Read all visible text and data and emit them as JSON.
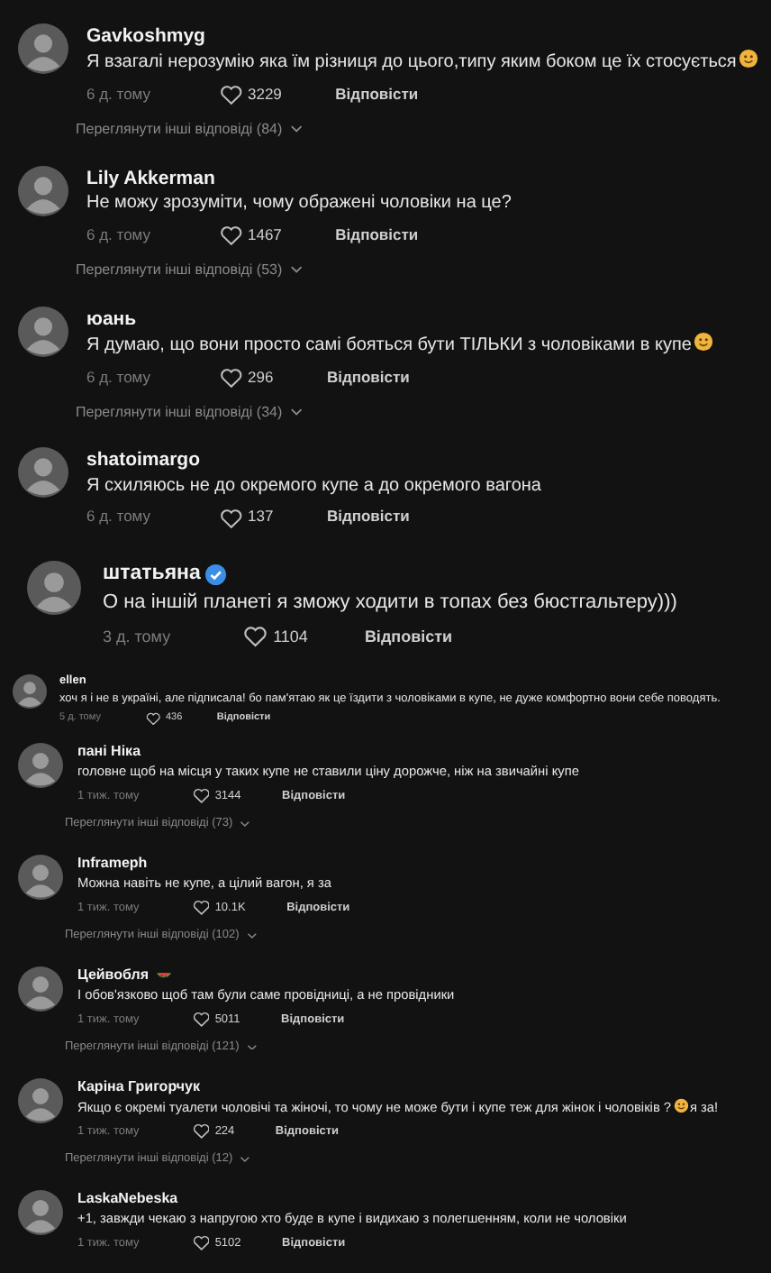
{
  "comments": [
    {
      "kind": "large",
      "author": "Gavkoshmyg",
      "segments": [
        {
          "kind": "text",
          "text": "Я взагалі нерозумію яка їм різниця до цього,типу яким боком це їх стосується"
        },
        {
          "kind": "emoji"
        }
      ],
      "time": "6 д. тому",
      "likes": "3229",
      "reply": "Відповісти",
      "more_replies": "Переглянути інші відповіді (84)"
    },
    {
      "kind": "large",
      "author": "Lily Akkerman",
      "segments": [
        {
          "kind": "text",
          "text": "Не можу зрозуміти, чому ображені чоловіки на це?"
        }
      ],
      "time": "6 д. тому",
      "likes": "1467",
      "reply": "Відповісти",
      "more_replies": "Переглянути інші відповіді (53)"
    },
    {
      "kind": "large",
      "author": "юань",
      "segments": [
        {
          "kind": "text",
          "text": "Я думаю, що вони просто самі бояться бути ТІЛЬКИ з чоловіками в купе"
        },
        {
          "kind": "emoji"
        }
      ],
      "time": "6 д. тому",
      "likes": "296",
      "reply": "Відповісти",
      "more_replies": "Переглянути інші відповіді (34)"
    },
    {
      "kind": "large",
      "author": "shatoimargo",
      "segments": [
        {
          "kind": "text",
          "text": "Я схиляюсь не до окремого купе а до окремого вагона"
        }
      ],
      "time": "6 д. тому",
      "likes": "137",
      "reply": "Відповісти"
    },
    {
      "kind": "xlarge",
      "author": "штатьяна",
      "verified": true,
      "segments": [
        {
          "kind": "text",
          "text": "О на іншій планеті я зможу ходити в топах без бюстгальтеру)))"
        }
      ],
      "time": "3 д. тому",
      "likes": "1104",
      "reply": "Відповісти"
    },
    {
      "kind": "tiny",
      "author": "ellen",
      "segments": [
        {
          "kind": "text",
          "text": "хоч я і не в україні, але підписала! бо пам'ятаю як це їздити з чоловіками в купе, не дуже комфортно вони себе поводять."
        }
      ],
      "time": "5 д. тому",
      "likes": "436",
      "reply": "Відповісти"
    },
    {
      "kind": "medium",
      "author": "пані Ніка",
      "segments": [
        {
          "kind": "text",
          "text": "головне щоб на місця у таких купе не ставили ціну дорожче, ніж на звичайні купе"
        }
      ],
      "time": "1 тиж. тому",
      "likes": "3144",
      "reply": "Відповісти",
      "more_replies": "Переглянути інші відповіді (73)"
    },
    {
      "kind": "medium",
      "author": "Inframeph",
      "segments": [
        {
          "kind": "text",
          "text": "Можна навіть не купе, а цілий вагон, я за"
        }
      ],
      "time": "1 тиж. тому",
      "likes": "10.1K",
      "reply": "Відповісти",
      "more_replies": "Переглянути інші відповіді (102)"
    },
    {
      "kind": "medium",
      "author": "Цейвобля",
      "name_emoji": true,
      "segments": [
        {
          "kind": "text",
          "text": "І обов'язково щоб там були саме провідниці, а не провідники"
        }
      ],
      "time": "1 тиж. тому",
      "likes": "5011",
      "reply": "Відповісти",
      "more_replies": "Переглянути інші відповіді (121)"
    },
    {
      "kind": "medium",
      "author": "Каріна Григорчук",
      "segments": [
        {
          "kind": "text",
          "text": "Якщо є окремі туалети чоловічі та жіночі, то чому не може бути і купе теж для жінок і чоловіків ?"
        },
        {
          "kind": "emoji"
        },
        {
          "kind": "text",
          "text": "я за!"
        }
      ],
      "time": "1 тиж. тому",
      "likes": "224",
      "reply": "Відповісти",
      "more_replies": "Переглянути інші відповіді (12)"
    },
    {
      "kind": "medium",
      "author": "LaskaNebeska",
      "segments": [
        {
          "kind": "text",
          "text": "+1, завжди чекаю з напругою хто буде в купе і видихаю з полегшенням, коли не чоловіки"
        }
      ],
      "time": "1 тиж. тому",
      "likes": "5102",
      "reply": "Відповісти"
    }
  ]
}
